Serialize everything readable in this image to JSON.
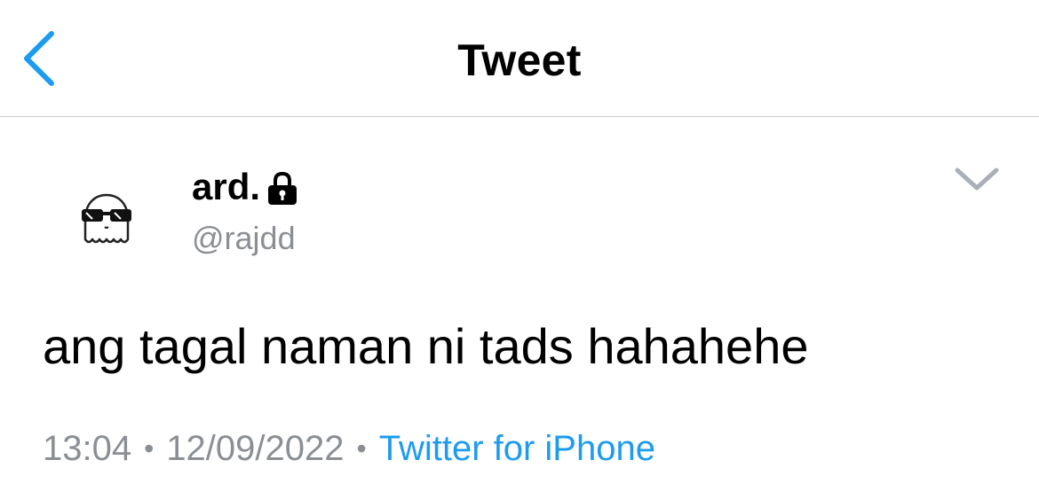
{
  "nav": {
    "title": "Tweet",
    "back_icon": "chevron-left-icon"
  },
  "author": {
    "display_name": "ard.",
    "handle": "@rajdd",
    "protected_icon": "lock-icon",
    "avatar": "ghost-with-sunglasses-avatar"
  },
  "menu": {
    "icon": "chevron-down-icon"
  },
  "tweet": {
    "text": "ang tagal naman ni tads hahahehe"
  },
  "meta": {
    "time": "13:04",
    "separator": "•",
    "date": "12/09/2022",
    "source": "Twitter for iPhone"
  },
  "colors": {
    "accent": "#1d9bf0",
    "secondary_text": "#8b8f94",
    "divider": "#c7c7cc"
  }
}
